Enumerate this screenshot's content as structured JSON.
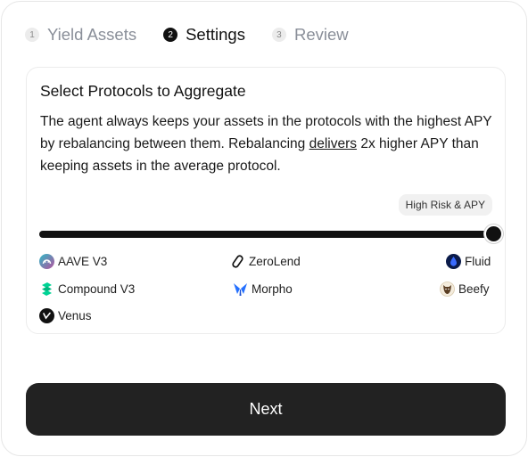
{
  "stepper": {
    "steps": [
      {
        "number": "1",
        "label": "Yield Assets",
        "state": "done"
      },
      {
        "number": "2",
        "label": "Settings",
        "state": "active"
      },
      {
        "number": "3",
        "label": "Review",
        "state": "upcoming"
      }
    ]
  },
  "card": {
    "title": "Select Protocols to Aggregate",
    "description": {
      "part1": "The agent always keeps your assets in the protocols with the highest APY by rebalancing between them. Rebalancing ",
      "underlined": "delivers",
      "part2": " 2x higher APY than keeping assets in the average protocol."
    },
    "risk_badge": "High Risk & APY",
    "slider": {
      "value_fraction": 1.0
    }
  },
  "protocols": [
    {
      "name": "AAVE V3",
      "icon": "aave-icon"
    },
    {
      "name": "ZeroLend",
      "icon": "zerolend-icon"
    },
    {
      "name": "Fluid",
      "icon": "fluid-icon"
    },
    {
      "name": "Compound V3",
      "icon": "compound-icon"
    },
    {
      "name": "Morpho",
      "icon": "morpho-icon"
    },
    {
      "name": "Beefy",
      "icon": "beefy-icon"
    },
    {
      "name": "Venus",
      "icon": "venus-icon"
    }
  ],
  "colors": {
    "accent": "#111111",
    "button_bg": "#222222",
    "aave": "#b6509e",
    "compound": "#00d395",
    "morpho": "#2470ff",
    "fluid": "#1f3fbf"
  },
  "next_button": {
    "label": "Next"
  }
}
